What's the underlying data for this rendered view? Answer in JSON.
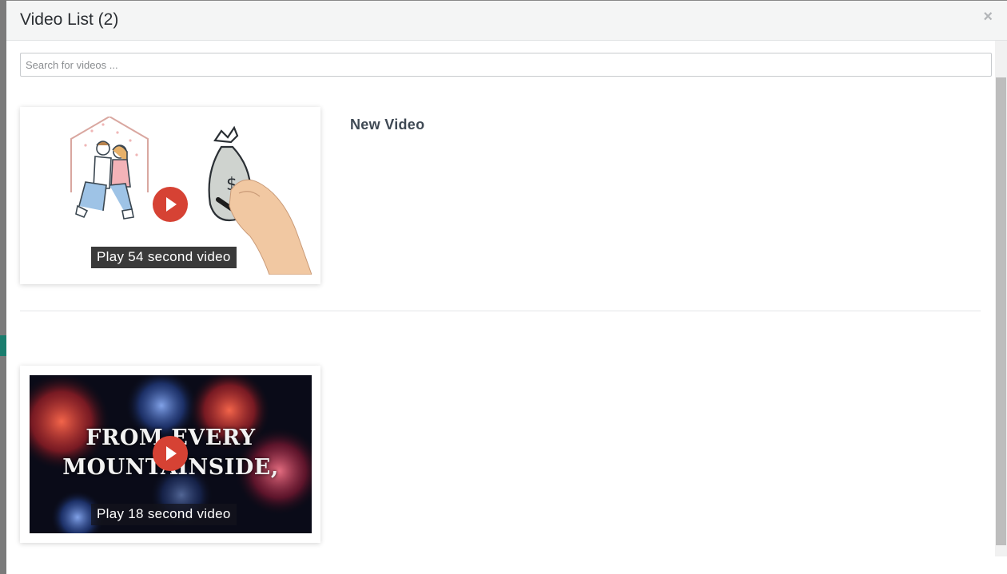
{
  "modal": {
    "title": "Video List (2)",
    "close_label": "×"
  },
  "search": {
    "placeholder": "Search for videos ...",
    "value": ""
  },
  "videos": [
    {
      "title": "New Video",
      "play_caption": "Play 54 second video",
      "thumbnail_style": "whiteboard-drawing",
      "play_color": "#d64234"
    },
    {
      "title": "",
      "play_caption": "Play 18 second video",
      "thumbnail_style": "fireworks",
      "overlay_text": [
        "FROM EVERY",
        "MOUNTAINSIDE,"
      ],
      "play_color": "#d64234"
    }
  ],
  "colors": {
    "header_bg": "#f4f5f5",
    "title_text": "#2b2f33",
    "video_title": "#3f4954",
    "play_button": "#d64234"
  }
}
